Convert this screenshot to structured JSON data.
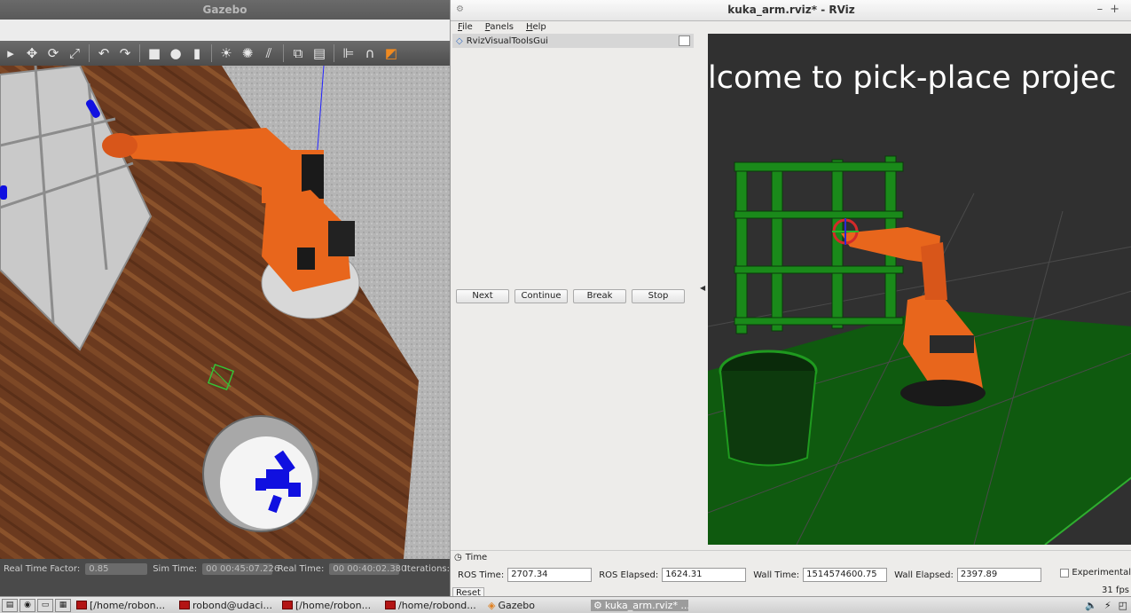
{
  "gazebo": {
    "title": "Gazebo",
    "statusbar": {
      "rtf_label": "Real Time Factor:",
      "rtf_value": "0.85",
      "sim_time_label": "Sim Time:",
      "sim_time_value": "00 00:45:07.226",
      "real_time_label": "Real Time:",
      "real_time_value": "00 00:40:02.380",
      "iterations_label": "Iterations:"
    }
  },
  "rviz": {
    "title": "kuka_arm.rviz* - RViz",
    "menu": [
      "File",
      "Panels",
      "Help"
    ],
    "panel": {
      "title": "RvizVisualToolsGui",
      "buttons": [
        "Next",
        "Continue",
        "Break",
        "Stop"
      ]
    },
    "viewport": {
      "banner": "lcome  to  pick-place  projec"
    },
    "time_panel": {
      "title": "Time",
      "ros_time_label": "ROS Time:",
      "ros_time_value": "2707.34",
      "ros_elapsed_label": "ROS Elapsed:",
      "ros_elapsed_value": "1624.31",
      "wall_time_label": "Wall Time:",
      "wall_time_value": "1514574600.75",
      "wall_elapsed_label": "Wall Elapsed:",
      "wall_elapsed_value": "2397.89",
      "experimental_label": "Experimental",
      "reset_label": "Reset",
      "fps": "31 fps"
    }
  },
  "taskbar": {
    "tasks": [
      {
        "label": "[/home/robon..."
      },
      {
        "label": "robond@udaci..."
      },
      {
        "label": "[/home/robon..."
      },
      {
        "label": "/home/robond..."
      },
      {
        "label": "Gazebo"
      },
      {
        "label": "kuka_arm.rviz* ..."
      }
    ]
  },
  "colors": {
    "robot_orange": "#e8661c",
    "shelf_green": "#1e9a1e",
    "floor_green": "#0f5a0f",
    "wood": "#6b3a1f"
  }
}
